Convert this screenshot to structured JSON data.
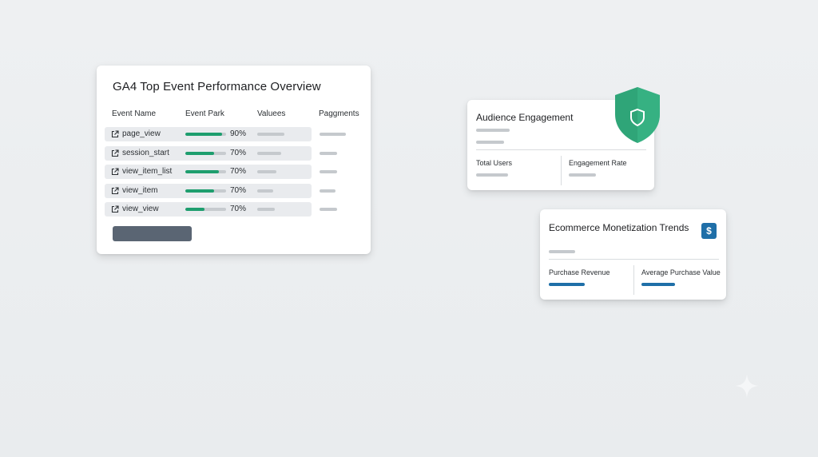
{
  "main_card": {
    "title": "GA4 Top Event Performance Overview",
    "headers": {
      "event_name": "Event Name",
      "event_park": "Event Park",
      "valuees": "Valuees",
      "paggments": "Paggments"
    },
    "rows": [
      {
        "name": "page_view",
        "pct": "90%",
        "fill": 0.9
      },
      {
        "name": "session_start",
        "pct": "70%",
        "fill": 0.7
      },
      {
        "name": "view_item_list",
        "pct": "70%",
        "fill": 0.82
      },
      {
        "name": "view_item",
        "pct": "70%",
        "fill": 0.7
      },
      {
        "name": "view_view",
        "pct": "70%",
        "fill": 0.47
      }
    ]
  },
  "audience_card": {
    "title": "Audience Engagement",
    "metric1": "Total Users",
    "metric2": "Engagement Rate"
  },
  "ecommerce_card": {
    "title": "Ecommerce Monetization Trends",
    "metric1": "Purchase Revenue",
    "metric2": "Average Purchase Value",
    "badge": "$"
  },
  "icons": [
    "external-link-icon",
    "shield-icon",
    "dollar-icon",
    "sparkle-icon"
  ],
  "colors": {
    "accent_green": "#1e9e6e",
    "accent_blue": "#1f6fa8",
    "button": "#5a6573",
    "background": "#eceef0"
  }
}
